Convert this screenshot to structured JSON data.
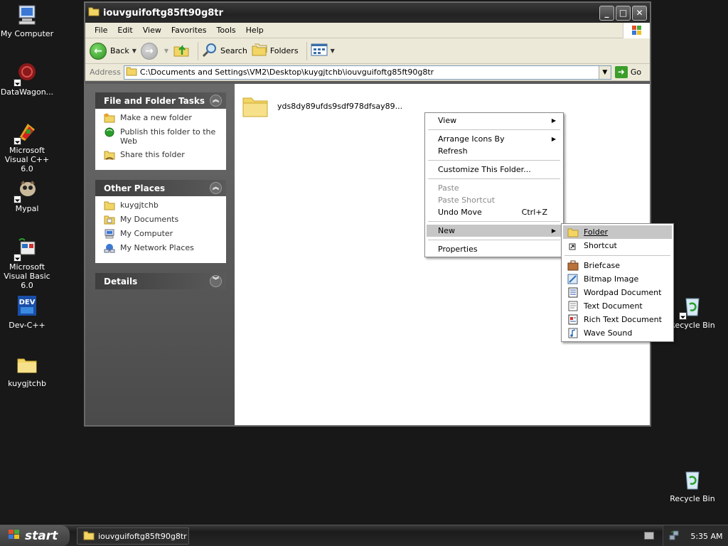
{
  "desktop": {
    "icons": [
      {
        "label": "My Computer"
      },
      {
        "label": "DataWagon..."
      },
      {
        "label": "Microsoft Visual C++ 6.0"
      },
      {
        "label": "Mypal"
      },
      {
        "label": "Microsoft Visual Basic 6.0"
      },
      {
        "label": "Dev-C++"
      },
      {
        "label": "kuygjtchb"
      },
      {
        "label": "Recycle Bin"
      },
      {
        "label": "Recycle Bin"
      }
    ],
    "background_color": "#181818"
  },
  "window": {
    "title": "iouvguifoftg85ft90g8tr",
    "menu": [
      "File",
      "Edit",
      "View",
      "Favorites",
      "Tools",
      "Help"
    ],
    "toolbar": {
      "back_label": "Back",
      "search_label": "Search",
      "folders_label": "Folders"
    },
    "address": {
      "label": "Address",
      "value": "C:\\Documents and Settings\\VM2\\Desktop\\kuygjtchb\\iouvguifoftg85ft90g8tr",
      "go_label": "Go"
    },
    "tasks_panel": {
      "title": "File and Folder Tasks",
      "items": [
        "Make a new folder",
        "Publish this folder to the Web",
        "Share this folder"
      ]
    },
    "other_places_panel": {
      "title": "Other Places",
      "items": [
        "kuygjtchb",
        "My Documents",
        "My Computer",
        "My Network Places"
      ]
    },
    "details_panel": {
      "title": "Details"
    },
    "files": [
      {
        "name": "yds8dy89ufds9sdf978dfsay89..."
      }
    ]
  },
  "context_menu": {
    "items": [
      {
        "label": "View",
        "submenu": true
      },
      {
        "label": "Arrange Icons By",
        "submenu": true
      },
      {
        "label": "Refresh"
      },
      {
        "label": "Customize This Folder..."
      },
      {
        "label": "Paste",
        "disabled": true
      },
      {
        "label": "Paste Shortcut",
        "disabled": true
      },
      {
        "label": "Undo Move",
        "shortcut": "Ctrl+Z"
      },
      {
        "label": "New",
        "submenu": true,
        "active": true
      },
      {
        "label": "Properties"
      }
    ]
  },
  "new_submenu": {
    "items": [
      {
        "label": "Folder",
        "active": true
      },
      {
        "label": "Shortcut"
      },
      {
        "label": "Briefcase"
      },
      {
        "label": "Bitmap Image"
      },
      {
        "label": "Wordpad Document"
      },
      {
        "label": "Text Document"
      },
      {
        "label": "Rich Text Document"
      },
      {
        "label": "Wave Sound"
      }
    ]
  },
  "taskbar": {
    "start_label": "start",
    "task_label": "iouvguifoftg85ft90g8tr",
    "clock": "5:35 AM"
  }
}
